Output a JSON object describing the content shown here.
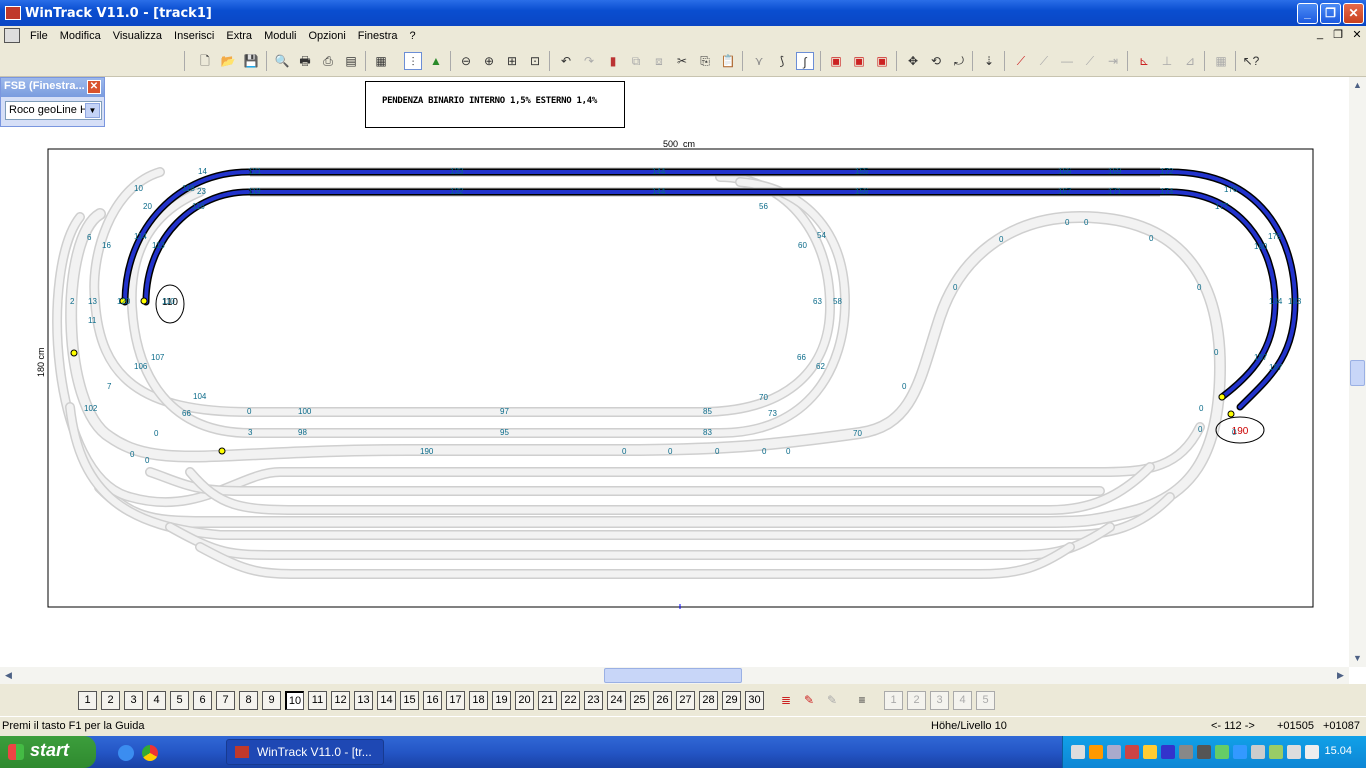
{
  "window": {
    "title": "WinTrack  V11.0 - [track1]"
  },
  "menu": [
    "File",
    "Modifica",
    "Visualizza",
    "Inserisci",
    "Extra",
    "Moduli",
    "Opzioni",
    "Finestra",
    "?"
  ],
  "fsb": {
    "title": "FSB (Finestra...",
    "selected": "Roco geoLine H"
  },
  "note": "PENDENZA BINARIO INTERNO 1,5% ESTERNO 1,4%",
  "plan": {
    "width_label": "500_cm",
    "height_label": "180 cm",
    "callout_left": "110",
    "callout_right": "190",
    "numbers": [
      "14",
      "121",
      "133",
      "144",
      "155",
      "166",
      "169",
      "172",
      "10",
      "118",
      "23",
      "119",
      "132",
      "144",
      "156",
      "167",
      "171",
      "174",
      "176",
      "20",
      "116",
      "56",
      "177",
      "6",
      "16",
      "114",
      "54",
      "0",
      "0",
      "0",
      "179",
      "113",
      "60",
      "0",
      "180",
      "2",
      "13",
      "120",
      "110",
      "63",
      "58",
      "0",
      "184",
      "183",
      "11",
      "0",
      "66",
      "62",
      "187",
      "107",
      "106",
      "0",
      "187",
      "7",
      "104",
      "0",
      "70",
      "0",
      "100",
      "97",
      "85",
      "73",
      "66",
      "102",
      "0",
      "0",
      "3",
      "98",
      "95",
      "83",
      "70",
      "0",
      "0",
      "190",
      "0",
      "0",
      "0",
      "0",
      "0",
      "0",
      "0",
      "0"
    ]
  },
  "levels": [
    "1",
    "2",
    "3",
    "4",
    "5",
    "6",
    "7",
    "8",
    "9",
    "10",
    "11",
    "12",
    "13",
    "14",
    "15",
    "16",
    "17",
    "18",
    "19",
    "20",
    "21",
    "22",
    "23",
    "24",
    "25",
    "26",
    "27",
    "28",
    "29",
    "30"
  ],
  "status": {
    "help": "Premi il tasto F1 per la Guida",
    "level": "Höhe/Livello 10",
    "track": "<- 112 ->",
    "x": "+01505",
    "y": "+01087"
  },
  "taskbar": {
    "start": "start",
    "app": "WinTrack  V11.0 - [tr...",
    "clock": "15.04"
  }
}
